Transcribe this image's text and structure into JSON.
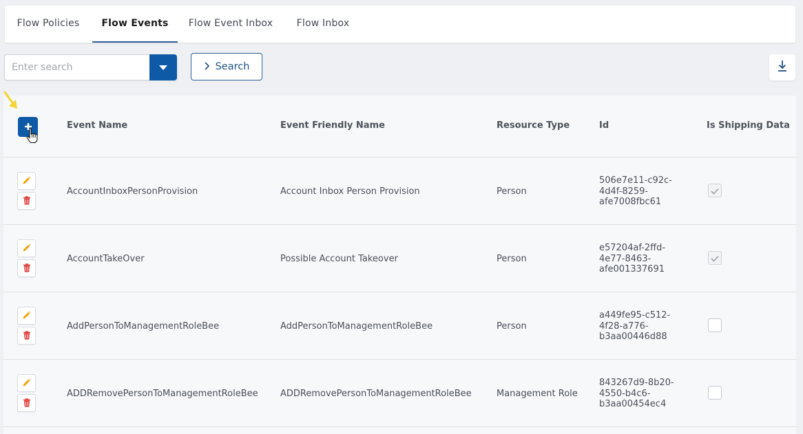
{
  "tabs": [
    {
      "label": "Flow Policies",
      "active": false
    },
    {
      "label": "Flow Events",
      "active": true
    },
    {
      "label": "Flow Event Inbox",
      "active": false
    },
    {
      "label": "Flow Inbox",
      "active": false
    }
  ],
  "search": {
    "placeholder": "Enter search",
    "value": "",
    "button_label": "Search"
  },
  "icons": {
    "dropdown": "chevron-down-icon",
    "search_chevron": "chevron-right-icon",
    "download": "download-icon",
    "add": "plus-icon",
    "edit": "pencil-icon",
    "delete": "trash-icon"
  },
  "colors": {
    "primary": "#0e5aa7",
    "edit_icon": "#f0a30a",
    "delete_icon": "#e03a3a",
    "annotation_arrow": "#f4d533"
  },
  "table": {
    "columns": [
      "Event Name",
      "Event Friendly Name",
      "Resource Type",
      "Id",
      "Is Shipping Data"
    ],
    "rows": [
      {
        "event_name": "AccountInboxPersonProvision",
        "friendly_name": "Account Inbox Person Provision",
        "resource_type": "Person",
        "id": "506e7e11-c92c-4d4f-8259-afe7008fbc61",
        "is_shipping_data": true
      },
      {
        "event_name": "AccountTakeOver",
        "friendly_name": "Possible Account Takeover",
        "resource_type": "Person",
        "id": "e57204af-2ffd-4e77-8463-afe001337691",
        "is_shipping_data": true
      },
      {
        "event_name": "AddPersonToManagementRoleBee",
        "friendly_name": "AddPersonToManagementRoleBee",
        "resource_type": "Person",
        "id": "a449fe95-c512-4f28-a776-b3aa00446d88",
        "is_shipping_data": false
      },
      {
        "event_name": "ADDRemovePersonToManagementRoleBee",
        "friendly_name": "ADDRemovePersonToManagementRoleBee",
        "resource_type": "Management Role",
        "id": "843267d9-8b20-4550-b4c6-b3aa00454ec4",
        "is_shipping_data": false
      }
    ]
  }
}
